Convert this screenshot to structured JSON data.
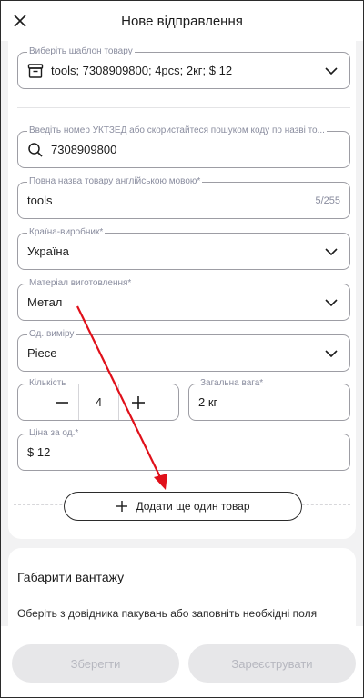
{
  "header": {
    "title": "Нове відправлення",
    "close_icon": "close-icon"
  },
  "template": {
    "label": "Виберіть шаблон товару",
    "value": "tools; 7308909800; 4pcs; 2кг; $ 12",
    "icon": "box-icon"
  },
  "hs_code": {
    "label": "Введіть номер УКТЗЕД або скористайтеся пошуком коду по назві то...",
    "value": "7308909800",
    "icon": "search-icon"
  },
  "product_name": {
    "label": "Повна назва товару англійською мовою*",
    "value": "tools",
    "counter": "5/255"
  },
  "country": {
    "label": "Країна-виробник*",
    "value": "Україна"
  },
  "material": {
    "label": "Матеріал виготовлення*",
    "value": "Метал"
  },
  "unit": {
    "label": "Од. виміру",
    "value": "Piece"
  },
  "quantity": {
    "label": "Кількість",
    "value": "4"
  },
  "weight": {
    "label": "Загальна вага*",
    "value": "2 кг"
  },
  "price": {
    "label": "Ціна за од.*",
    "value": "$ 12"
  },
  "add_item": {
    "label": "Додати ще один товар"
  },
  "cargo": {
    "title": "Габарити вантажу",
    "hint": "Оберіть з довідника пакувань або заповніть необхідні поля"
  },
  "footer": {
    "save_label": "Зберегти",
    "register_label": "Зареєструвати"
  },
  "colors": {
    "annotation_arrow": "#e0101a",
    "disabled_button": "#e7e7e9"
  }
}
